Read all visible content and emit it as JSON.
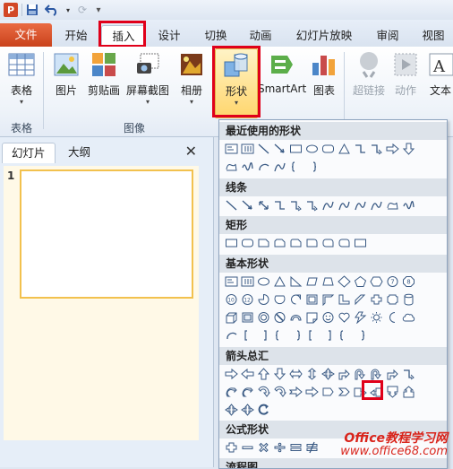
{
  "tabs": [
    {
      "label": "文件",
      "file": true
    },
    {
      "label": "开始"
    },
    {
      "label": "插入",
      "active": true
    },
    {
      "label": "设计"
    },
    {
      "label": "切换"
    },
    {
      "label": "动画"
    },
    {
      "label": "幻灯片放映"
    },
    {
      "label": "审阅"
    },
    {
      "label": "视图"
    }
  ],
  "ribbon": {
    "table": "表格",
    "picture": "图片",
    "clipart": "剪贴画",
    "screenshot": "屏幕截图",
    "album": "相册",
    "shapes": "形状",
    "smartart": "SmartArt",
    "chart": "图表",
    "hyperlink": "超链接",
    "action": "动作",
    "text": "文本",
    "groups": {
      "table": "表格",
      "images": "图像"
    }
  },
  "panel": {
    "tab_slides": "幻灯片",
    "tab_outline": "大纲",
    "slide_number": "1",
    "close": "✕"
  },
  "gallery": {
    "sections": [
      {
        "key": "recent",
        "label": "最近使用的形状"
      },
      {
        "key": "lines",
        "label": "线条"
      },
      {
        "key": "rect",
        "label": "矩形"
      },
      {
        "key": "basic",
        "label": "基本形状"
      },
      {
        "key": "arrows",
        "label": "箭头总汇"
      },
      {
        "key": "equation",
        "label": "公式形状"
      },
      {
        "key": "flowchart",
        "label": "流程图"
      }
    ]
  },
  "watermark": {
    "line1": "Office教程学习网",
    "line2": "www.office68.com"
  },
  "colors": {
    "accent_red": "#e0001a",
    "file_tab": "#d24726"
  }
}
